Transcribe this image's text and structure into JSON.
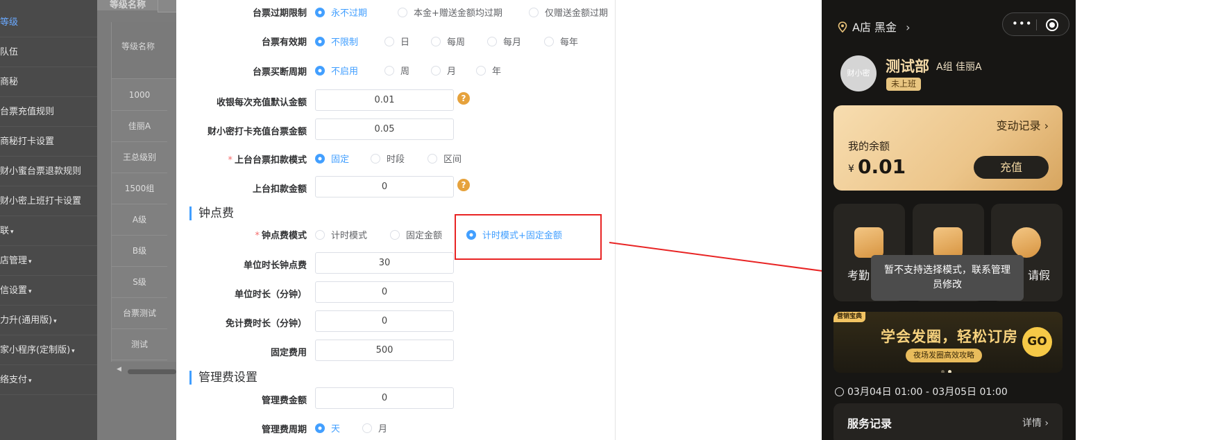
{
  "sidebar": {
    "items": [
      {
        "label": "等级",
        "active": true,
        "caret": false
      },
      {
        "label": "队伍",
        "active": false,
        "caret": false
      },
      {
        "label": "商秘",
        "active": false,
        "caret": false
      },
      {
        "label": "台票充值规则",
        "active": false,
        "caret": false
      },
      {
        "label": "商秘打卡设置",
        "active": false,
        "caret": false
      },
      {
        "label": "财小蜜台票退款规则",
        "active": false,
        "caret": false
      },
      {
        "label": "财小密上班打卡设置",
        "active": false,
        "caret": false
      },
      {
        "label": "联",
        "active": false,
        "caret": true
      },
      {
        "label": "店管理",
        "active": false,
        "caret": true
      },
      {
        "label": "信设置",
        "active": false,
        "caret": true
      },
      {
        "label": "力升(通用版)",
        "active": false,
        "caret": true
      },
      {
        "label": "家小程序(定制版)",
        "active": false,
        "caret": true
      },
      {
        "label": "络支付",
        "active": false,
        "caret": true
      }
    ],
    "caret_glyph": "▾"
  },
  "background_table": {
    "filter_label": "等级名称",
    "header": "等级名称",
    "rows": [
      "1000",
      "佳丽A",
      "王总级别",
      "1500组",
      "A级",
      "B级",
      "S级",
      "台票测试",
      "测试"
    ]
  },
  "form": {
    "rows": {
      "expiry_limit": {
        "label": "台票过期限制",
        "options": [
          "永不过期",
          "本金+赠送金额均过期",
          "仅赠送金额过期"
        ],
        "selected": 0
      },
      "validity": {
        "label": "台票有效期",
        "options": [
          "不限制",
          "日",
          "每周",
          "每月",
          "每年"
        ],
        "selected": 0
      },
      "buy_cycle": {
        "label": "台票买断周期",
        "options": [
          "不启用",
          "周",
          "月",
          "年"
        ],
        "selected": 0
      },
      "default_amount": {
        "label": "收银每次充值默认金额",
        "value": "0.01"
      },
      "checkin_amount": {
        "label": "财小密打卡充值台票金额",
        "value": "0.05"
      },
      "deduct_mode": {
        "label": "上台台票扣款模式",
        "required": true,
        "options": [
          "固定",
          "时段",
          "区间"
        ],
        "selected": 0
      },
      "deduct_amount": {
        "label": "上台扣款金额",
        "value": "0"
      }
    },
    "section_fee": "钟点费",
    "fee_rows": {
      "fee_mode": {
        "label": "钟点费模式",
        "required": true,
        "options": [
          "计时模式",
          "固定金额",
          "计时模式+固定金额"
        ],
        "selected": 2
      },
      "unit_fee": {
        "label": "单位时长钟点费",
        "value": "30"
      },
      "unit_minutes": {
        "label": "单位时长（分钟）",
        "value": "0"
      },
      "free_minutes": {
        "label": "免计费时长（分钟）",
        "value": "0"
      },
      "fixed_fee": {
        "label": "固定费用",
        "value": "500"
      }
    },
    "section_mgmt": "管理费设置",
    "mgmt_rows": {
      "mgmt_amount": {
        "label": "管理费金额",
        "value": "0"
      },
      "mgmt_cycle": {
        "label": "管理费周期",
        "options": [
          "天",
          "月"
        ],
        "selected": 0
      }
    },
    "required_mark": "*",
    "help_glyph": "?"
  },
  "annotation": {
    "color": "#e82323"
  },
  "phone": {
    "store": "A店 黑金",
    "store_chevron": "›",
    "capsule_dots": "•••",
    "avatar_text": "财小密",
    "name": "测试部",
    "group": "A组  佳丽A",
    "status": "未上班",
    "balance_card": {
      "link": "变动记录 ›",
      "label": "我的余额",
      "currency": "¥",
      "amount": "0.01",
      "button": "充值"
    },
    "tiles": [
      "考勤",
      "",
      "请假"
    ],
    "tooltip": "暂不支持选择模式，联系管理员修改",
    "banner": {
      "tag": "营销宝典",
      "title": "学会发圈，轻松订房",
      "subtitle": "夜场发圈高效攻略",
      "go": "GO"
    },
    "time_range": "03月04日 01:00 - 03月05日 01:00",
    "service": {
      "title": "服务记录",
      "link": "详情 ›"
    }
  },
  "colors": {
    "accent": "#409eff",
    "required": "#f56c6c",
    "help": "#e6a23c",
    "phone_gold": "#f3d9a7"
  }
}
